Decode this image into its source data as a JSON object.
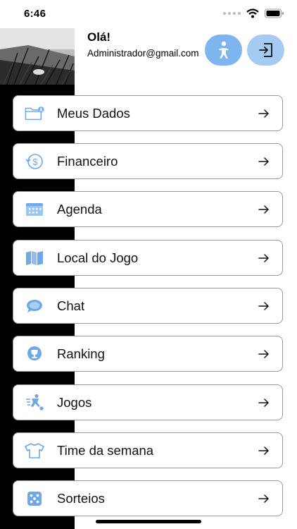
{
  "status_bar": {
    "time": "6:46"
  },
  "header": {
    "greeting": "Olá!",
    "email": "Administrador@gmail.com"
  },
  "colors": {
    "accent": "#7fb5ef",
    "icon_blue": "#6ea8e6",
    "border": "#9a9a9a"
  },
  "menu": {
    "items": [
      {
        "label": "Meus Dados",
        "icon": "folder-user-icon"
      },
      {
        "label": "Financeiro",
        "icon": "money-icon"
      },
      {
        "label": "Agenda",
        "icon": "calendar-icon"
      },
      {
        "label": "Local do Jogo",
        "icon": "map-icon"
      },
      {
        "label": "Chat",
        "icon": "chat-icon"
      },
      {
        "label": "Ranking",
        "icon": "trophy-icon"
      },
      {
        "label": "Jogos",
        "icon": "player-kick-icon"
      },
      {
        "label": "Time da semana",
        "icon": "shirt-icon"
      },
      {
        "label": "Sorteios",
        "icon": "dice-icon"
      }
    ]
  }
}
